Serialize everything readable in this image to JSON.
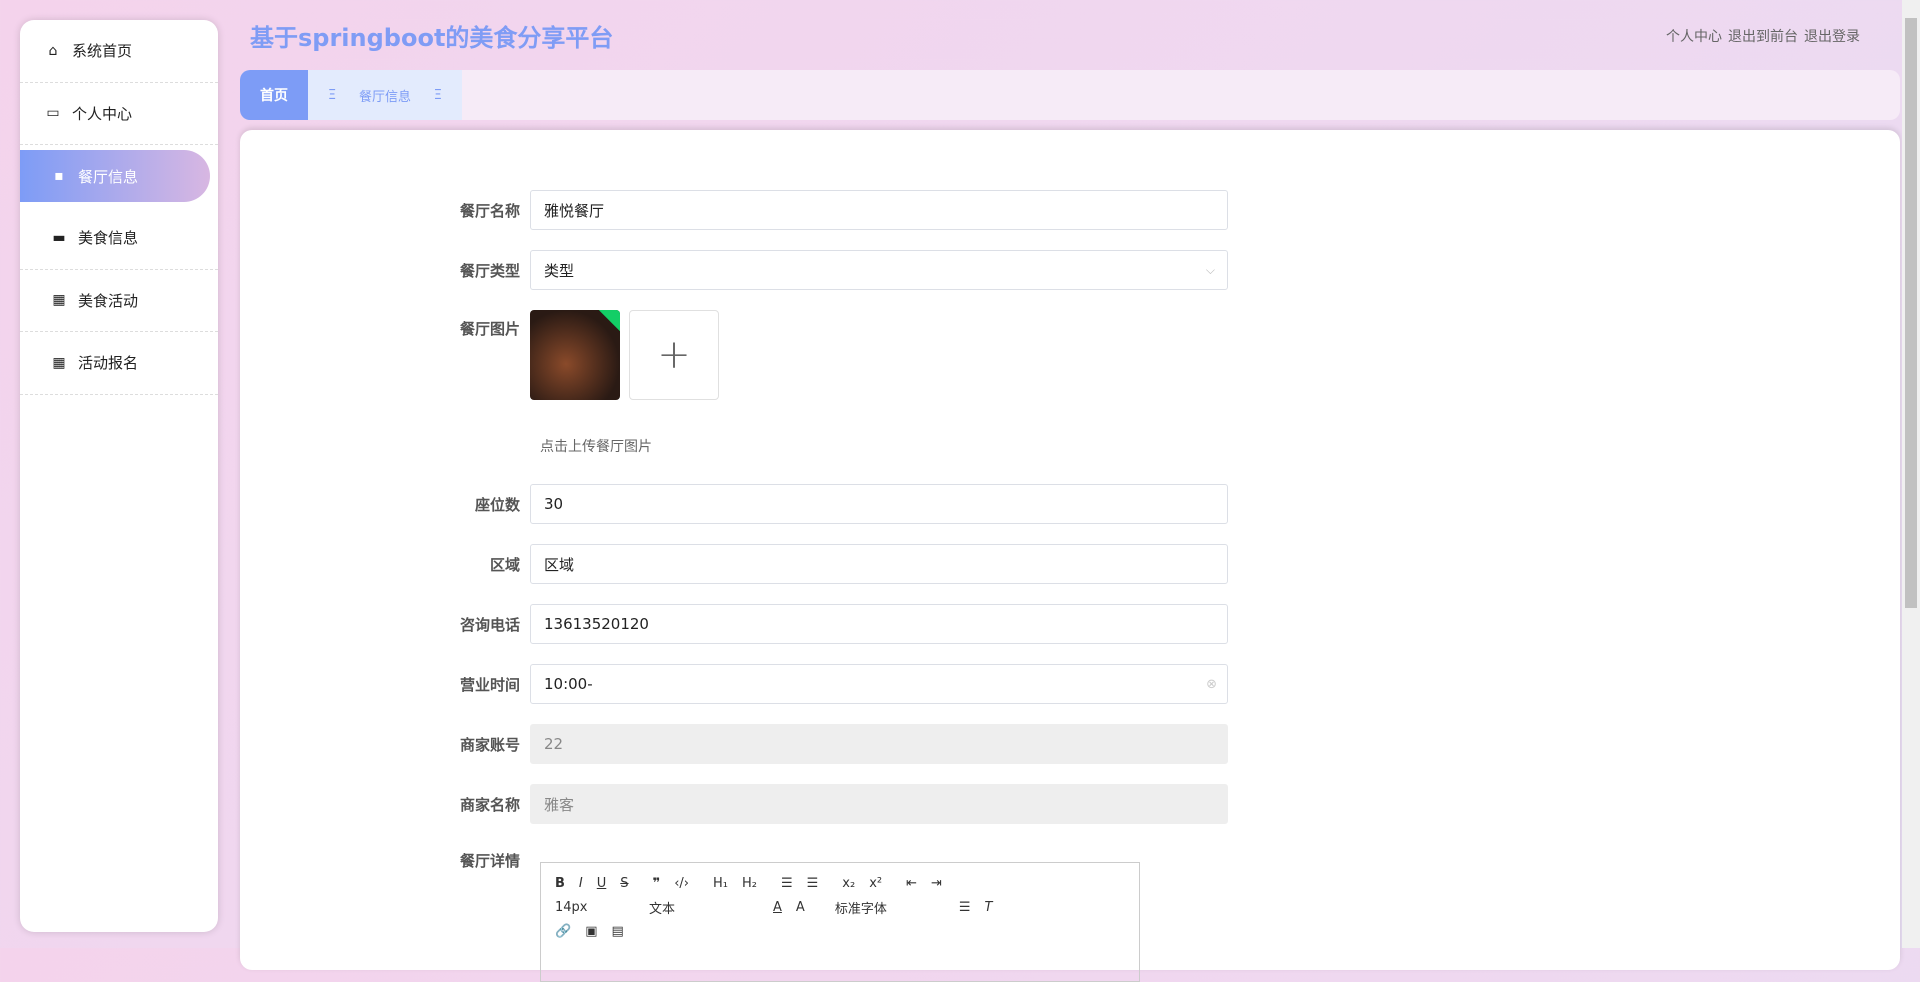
{
  "header": {
    "title": "基于springboot的美食分享平台",
    "links": [
      "个人中心",
      "退出到前台",
      "退出登录"
    ]
  },
  "sidebar": {
    "items": [
      {
        "label": "系统首页",
        "icon": "home-icon"
      },
      {
        "label": "个人中心",
        "icon": "wallet-icon"
      },
      {
        "label": "餐厅信息",
        "icon": "chair-icon"
      },
      {
        "label": "美食信息",
        "icon": "briefcase-icon"
      },
      {
        "label": "美食活动",
        "icon": "grid-icon"
      },
      {
        "label": "活动报名",
        "icon": "grid-icon"
      }
    ]
  },
  "tabs": {
    "home": "首页",
    "current": "餐厅信息"
  },
  "form": {
    "name_label": "餐厅名称",
    "name": "雅悦餐厅",
    "type_label": "餐厅类型",
    "type": "类型",
    "image_label": "餐厅图片",
    "image_hint": "点击上传餐厅图片",
    "seats_label": "座位数",
    "seats": "30",
    "region_label": "区域",
    "region": "区域",
    "phone_label": "咨询电话",
    "phone": "13613520120",
    "hours_label": "营业时间",
    "hours": "10:00-",
    "account_label": "商家账号",
    "account": "22",
    "merchant_label": "商家名称",
    "merchant": "雅客",
    "detail_label": "餐厅详情"
  },
  "editor": {
    "font_size": "14px",
    "heading": "文本",
    "font_family": "标准字体"
  }
}
